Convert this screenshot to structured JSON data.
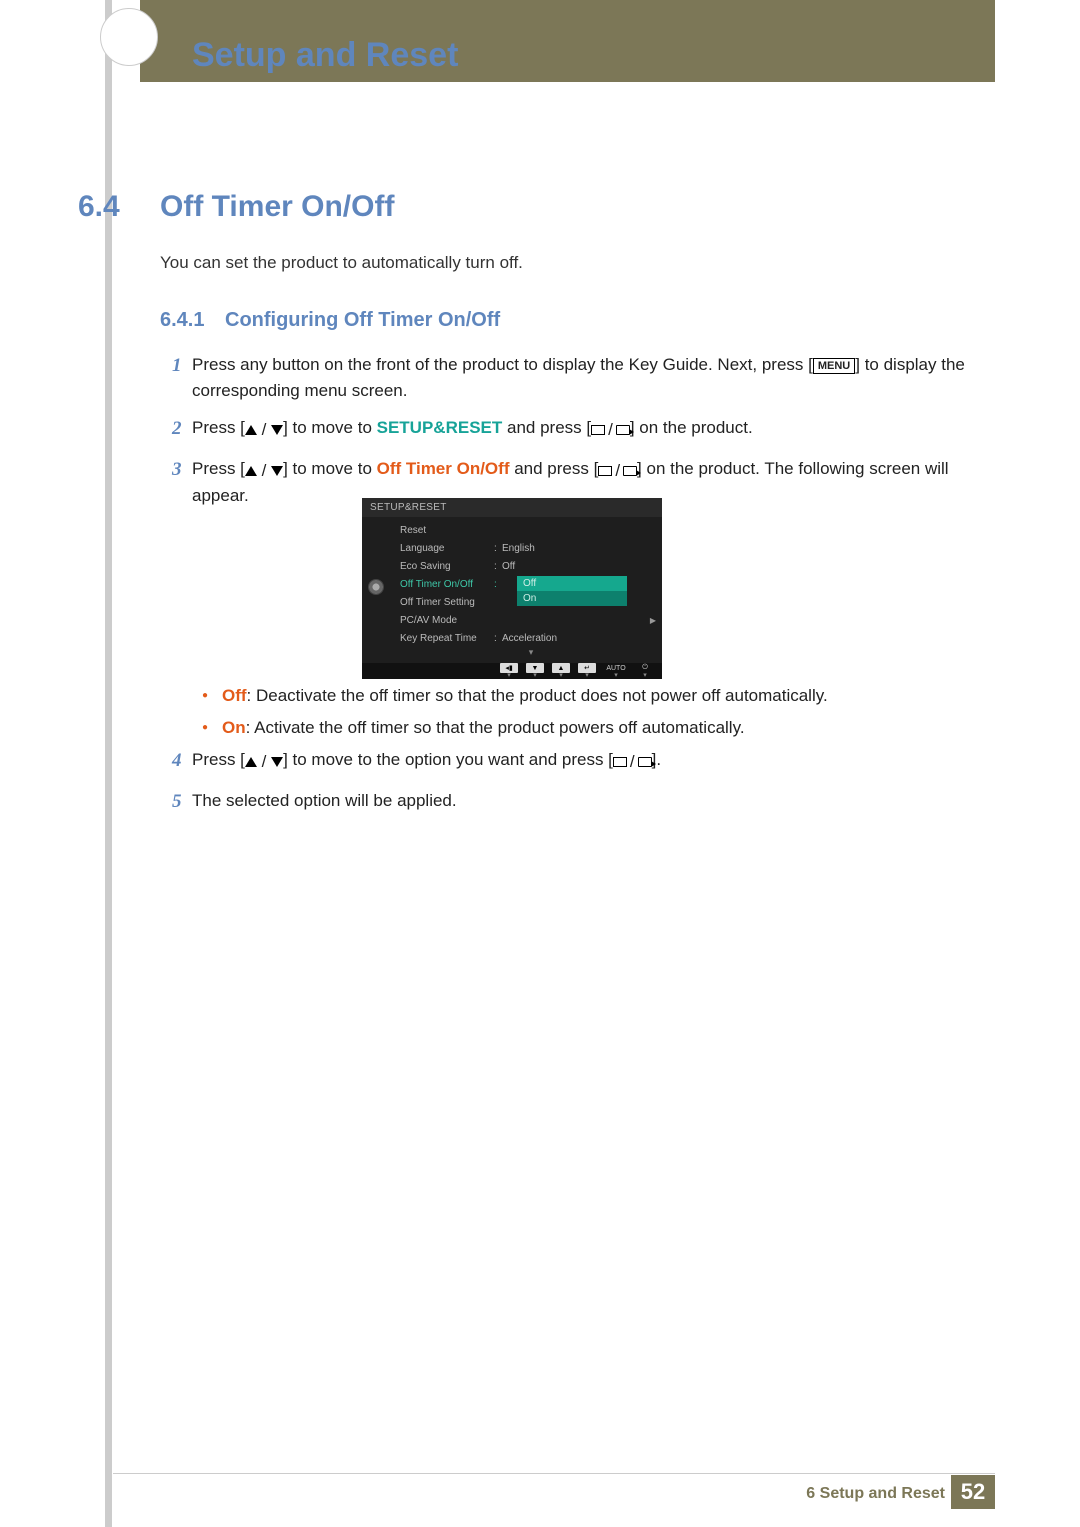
{
  "header": {
    "chapter_title": "Setup and Reset"
  },
  "section": {
    "number": "6.4",
    "title": "Off Timer On/Off"
  },
  "intro": "You can set the product to automatically turn off.",
  "subsection": {
    "number": "6.4.1",
    "title": "Configuring Off Timer On/Off"
  },
  "steps": {
    "s1_a": "Press any button on the front of the product to display the Key Guide. Next, press [",
    "s1_menu": "MENU",
    "s1_b": "] to display the corresponding menu screen.",
    "s2_a": "Press [",
    "s2_b": "] to move to ",
    "s2_hl": "SETUP&RESET",
    "s2_c": " and press [",
    "s2_d": "] on the product.",
    "s3_a": "Press [",
    "s3_b": "] to move to ",
    "s3_hl": "Off Timer On/Off",
    "s3_c": " and press [",
    "s3_d": "] on the product. The following screen will appear.",
    "s4_a": "Press [",
    "s4_b": "] to move to the option you want and press [",
    "s4_c": "].",
    "s5": "The selected option will be applied."
  },
  "osd": {
    "title": "SETUP&RESET",
    "rows": {
      "reset": "Reset",
      "language": "Language",
      "language_val": "English",
      "eco": "Eco Saving",
      "eco_val": "Off",
      "offtimer": "Off Timer On/Off",
      "offsetting": "Off Timer Setting",
      "pcav": "PC/AV Mode",
      "keyrepeat": "Key Repeat Time",
      "keyrepeat_val": "Acceleration"
    },
    "dropdown": {
      "off": "Off",
      "on": "On"
    },
    "auto": "AUTO"
  },
  "bullets": {
    "off_label": "Off",
    "off_text": ": Deactivate the off timer so that the product does not power off automatically.",
    "on_label": "On",
    "on_text": ": Activate the off timer so that the product powers off automatically."
  },
  "footer": {
    "text": "6 Setup and Reset",
    "page": "52"
  }
}
